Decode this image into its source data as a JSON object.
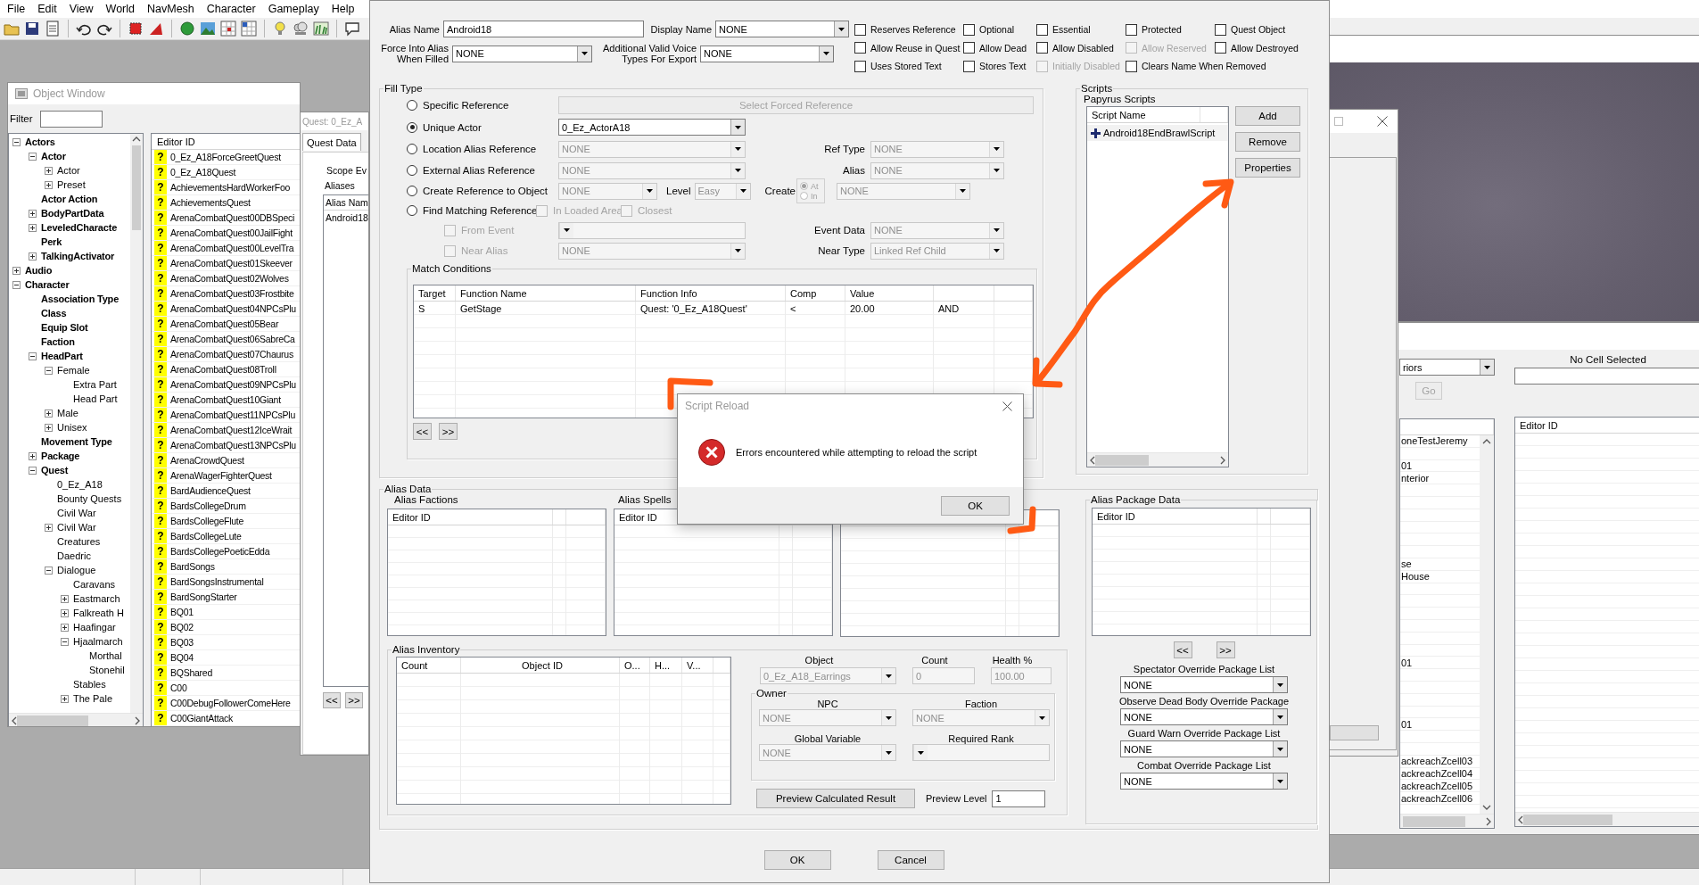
{
  "menu": [
    "File",
    "Edit",
    "View",
    "World",
    "NavMesh",
    "Character",
    "Gameplay",
    "Help"
  ],
  "object_window": {
    "title": "Object Window",
    "filter_label": "Filter",
    "list_header": "Editor ID",
    "tree": [
      {
        "label": "Actors",
        "expanded": true,
        "children": [
          {
            "label": "Actor",
            "expanded": true,
            "children": [
              {
                "label": "Actor",
                "expanded": false
              },
              {
                "label": "Preset",
                "expanded": false
              }
            ]
          },
          {
            "label": "Actor Action"
          },
          {
            "label": "BodyPartData",
            "expanded": false
          },
          {
            "label": "LeveledCharacte",
            "expanded": false
          },
          {
            "label": "Perk"
          },
          {
            "label": "TalkingActivator",
            "expanded": false
          }
        ]
      },
      {
        "label": "Audio",
        "expanded": false
      },
      {
        "label": "Character",
        "expanded": true,
        "children": [
          {
            "label": "Association Type"
          },
          {
            "label": "Class"
          },
          {
            "label": "Equip Slot"
          },
          {
            "label": "Faction"
          },
          {
            "label": "HeadPart",
            "expanded": true,
            "children": [
              {
                "label": "Female",
                "expanded": true,
                "children": [
                  {
                    "label": "Extra Part"
                  },
                  {
                    "label": "Head Part"
                  }
                ]
              },
              {
                "label": "Male",
                "expanded": false
              },
              {
                "label": "Unisex",
                "expanded": false
              }
            ]
          },
          {
            "label": "Movement Type"
          },
          {
            "label": "Package",
            "expanded": false
          },
          {
            "label": "Quest",
            "expanded": true,
            "children": [
              {
                "label": "0_Ez_A18"
              },
              {
                "label": "Bounty Quests"
              },
              {
                "label": "Civil War"
              },
              {
                "label": "Civil War",
                "expanded": false
              },
              {
                "label": "Creatures"
              },
              {
                "label": "Daedric"
              },
              {
                "label": "Dialogue",
                "expanded": true,
                "children": [
                  {
                    "label": "Caravans"
                  },
                  {
                    "label": "Eastmarch",
                    "expanded": false
                  },
                  {
                    "label": "Falkreath H",
                    "expanded": false
                  },
                  {
                    "label": "Haafingar",
                    "expanded": false
                  },
                  {
                    "label": "Hjaalmarch",
                    "expanded": true,
                    "children": [
                      {
                        "label": "Morthal"
                      },
                      {
                        "label": "Stonehil"
                      }
                    ]
                  },
                  {
                    "label": "Stables"
                  },
                  {
                    "label": "The Pale",
                    "expanded": false
                  }
                ]
              }
            ]
          }
        ]
      }
    ],
    "list": [
      {
        "mark": "?",
        "name": "0_Ez_A18ForceGreetQuest"
      },
      {
        "mark": "?",
        "name": "0_Ez_A18Quest"
      },
      {
        "mark": "?",
        "name": "AchievementsHardWorkerFoo"
      },
      {
        "mark": "?",
        "name": "AchievementsQuest"
      },
      {
        "mark": "?",
        "name": "ArenaCombatQuest00DBSpeci"
      },
      {
        "mark": "?",
        "name": "ArenaCombatQuest00JailFight"
      },
      {
        "mark": "?",
        "name": "ArenaCombatQuest00LevelTra"
      },
      {
        "mark": "?",
        "name": "ArenaCombatQuest01Skeever"
      },
      {
        "mark": "?",
        "name": "ArenaCombatQuest02Wolves"
      },
      {
        "mark": "?",
        "name": "ArenaCombatQuest03Frostbite"
      },
      {
        "mark": "?",
        "name": "ArenaCombatQuest04NPCsPlu"
      },
      {
        "mark": "?",
        "name": "ArenaCombatQuest05Bear"
      },
      {
        "mark": "?",
        "name": "ArenaCombatQuest06SabreCa"
      },
      {
        "mark": "?",
        "name": "ArenaCombatQuest07Chaurus"
      },
      {
        "mark": "?",
        "name": "ArenaCombatQuest08Troll"
      },
      {
        "mark": "?",
        "name": "ArenaCombatQuest09NPCsPlu"
      },
      {
        "mark": "?",
        "name": "ArenaCombatQuest10Giant"
      },
      {
        "mark": "?",
        "name": "ArenaCombatQuest11NPCsPlu"
      },
      {
        "mark": "?",
        "name": "ArenaCombatQuest12IceWrait"
      },
      {
        "mark": "?",
        "name": "ArenaCombatQuest13NPCsPlu"
      },
      {
        "mark": "?",
        "name": "ArenaCrowdQuest"
      },
      {
        "mark": "?",
        "name": "ArenaWagerFighterQuest"
      },
      {
        "mark": "?",
        "name": "BardAudienceQuest"
      },
      {
        "mark": "?",
        "name": "BardsCollegeDrum"
      },
      {
        "mark": "?",
        "name": "BardsCollegeFlute"
      },
      {
        "mark": "?",
        "name": "BardsCollegeLute"
      },
      {
        "mark": "?",
        "name": "BardsCollegePoeticEdda"
      },
      {
        "mark": "?",
        "name": "BardSongs"
      },
      {
        "mark": "?",
        "name": "BardSongsInstrumental"
      },
      {
        "mark": "?",
        "name": "BardSongStarter"
      },
      {
        "mark": "?",
        "name": "BQ01"
      },
      {
        "mark": "?",
        "name": "BQ02"
      },
      {
        "mark": "?",
        "name": "BQ03"
      },
      {
        "mark": "?",
        "name": "BQ04"
      },
      {
        "mark": "?",
        "name": "BQShared"
      },
      {
        "mark": "?",
        "name": "C00"
      },
      {
        "mark": "?",
        "name": "C00DebugFollowerComeHere"
      },
      {
        "mark": "?",
        "name": "C00GiantAttack"
      }
    ]
  },
  "quest_window": {
    "title": "Quest: 0_Ez_A",
    "tabs": [
      {
        "label": "Quest Data",
        "selected": true
      }
    ],
    "scope_label": "Scope Ev",
    "aliases_label": "Aliases",
    "alias_column": "Alias Nam",
    "aliases": [
      "Android18"
    ],
    "nav_buttons": [
      "<<",
      ">>"
    ]
  },
  "reference_alias": {
    "alias_name": {
      "label": "Alias Name",
      "value": "Android18"
    },
    "display_name": {
      "label": "Display Name",
      "value": "NONE"
    },
    "force_into_alias": {
      "label": "Force Into Alias When Filled",
      "value": "NONE"
    },
    "voice_types": {
      "label": "Additional Valid Voice Types For Export",
      "value": "NONE"
    },
    "flags": [
      {
        "label": "Reserves Reference",
        "checked": false,
        "disabled": false
      },
      {
        "label": "Optional",
        "checked": false,
        "disabled": false
      },
      {
        "label": "Essential",
        "checked": false,
        "disabled": false
      },
      {
        "label": "Protected",
        "checked": false,
        "disabled": false
      },
      {
        "label": "Quest Object",
        "checked": false,
        "disabled": false
      },
      {
        "label": "Allow Reuse in Quest",
        "checked": false,
        "disabled": false
      },
      {
        "label": "Allow Dead",
        "checked": false,
        "disabled": false
      },
      {
        "label": "Allow Disabled",
        "checked": false,
        "disabled": false
      },
      {
        "label": "Allow Reserved",
        "checked": false,
        "disabled": true
      },
      {
        "label": "Allow Destroyed",
        "checked": false,
        "disabled": false
      },
      {
        "label": "Uses Stored Text",
        "checked": false,
        "disabled": false
      },
      {
        "label": "Stores Text",
        "checked": false,
        "disabled": false
      },
      {
        "label": "Initially Disabled",
        "checked": false,
        "disabled": true
      },
      {
        "label": "Clears Name When Removed",
        "checked": false,
        "disabled": false
      }
    ],
    "fill_type": {
      "title": "Fill Type",
      "specific": {
        "label": "Specific Reference",
        "selected": false,
        "disabled": true,
        "button": "Select Forced Reference"
      },
      "unique": {
        "label": "Unique Actor",
        "selected": true,
        "disabled": false,
        "value": "0_Ez_ActorA18"
      },
      "location": {
        "label": "Location Alias Reference",
        "selected": false,
        "disabled": true,
        "value": "NONE",
        "ref_type_label": "Ref Type",
        "ref_type": "NONE"
      },
      "external": {
        "label": "External Alias Reference",
        "selected": false,
        "disabled": true,
        "value": "NONE",
        "alias_label": "Alias",
        "alias": "NONE"
      },
      "create": {
        "label": "Create Reference to Object",
        "selected": false,
        "disabled": true,
        "value": "NONE",
        "level_label": "Level",
        "level": "Easy",
        "create_label": "Create",
        "at": {
          "label": "At",
          "selected": true
        },
        "in": {
          "label": "In",
          "selected": false
        },
        "target": "NONE"
      },
      "find": {
        "label": "Find Matching Reference",
        "selected": false,
        "disabled": true,
        "in_loaded_area": {
          "label": "In Loaded Area",
          "checked": false
        },
        "closest": {
          "label": "Closest",
          "checked": false
        }
      },
      "from_event": {
        "label": "From Event",
        "checked": false,
        "disabled": true,
        "event_data_label": "Event Data",
        "event_data": "NONE"
      },
      "near_alias": {
        "label": "Near Alias",
        "checked": false,
        "disabled": true,
        "value": "NONE",
        "near_type_label": "Near Type",
        "near_type": "Linked Ref Child"
      },
      "match_conditions": {
        "title": "Match Conditions",
        "columns": [
          "Target",
          "Function Name",
          "Function Info",
          "Comp",
          "Value"
        ],
        "rows": [
          [
            "S",
            "GetStage",
            "Quest: '0_Ez_A18Quest'",
            "<",
            "20.00",
            "AND"
          ]
        ],
        "nav_buttons": [
          "<<",
          ">>"
        ]
      }
    },
    "scripts": {
      "title": "Scripts",
      "subtitle": "Papyrus Scripts",
      "column": "Script Name",
      "items": [
        "Android18EndBrawlScript"
      ],
      "buttons": [
        "Add",
        "Remove",
        "Properties"
      ]
    },
    "alias_data": {
      "title": "Alias Data",
      "factions": {
        "title": "Alias Factions",
        "column": "Editor ID"
      },
      "spells": {
        "title": "Alias Spells",
        "column": "Editor ID"
      },
      "inventory": {
        "title": "Alias Inventory",
        "columns": [
          "Count",
          "Object ID",
          "O...",
          "H...",
          "V..."
        ],
        "object_label": "Object",
        "object": "0_Ez_A18_Earrings",
        "count_label": "Count",
        "count": "0",
        "health_label": "Health %",
        "health": "100.00",
        "owner": {
          "title": "Owner",
          "npc_label": "NPC",
          "npc": "NONE",
          "faction_label": "Faction",
          "faction": "NONE",
          "global_label": "Global Variable",
          "global": "NONE",
          "rank_label": "Required Rank"
        },
        "preview_button": "Preview Calculated Result",
        "preview_level_label": "Preview Level",
        "preview_level": "1"
      },
      "package": {
        "title": "Alias Package Data",
        "column": "Editor ID",
        "nav_buttons": [
          "<<",
          ">>"
        ],
        "overrides": [
          {
            "label": "Spectator Override Package List",
            "value": "NONE"
          },
          {
            "label": "Observe Dead Body Override Package",
            "value": "NONE"
          },
          {
            "label": "Guard Warn Override Package List",
            "value": "NONE"
          },
          {
            "label": "Combat Override Package List",
            "value": "NONE"
          }
        ]
      }
    },
    "buttons": [
      "OK",
      "Cancel"
    ]
  },
  "script_reload": {
    "title": "Script Reload",
    "message": "Errors encountered while attempting to reload the script",
    "button": "OK"
  },
  "cell_view": {
    "world": "riors",
    "go_button": "Go",
    "status": "No Cell Selected",
    "list_header": "Editor ID",
    "cells": [
      {
        "text": "oneTestJeremy"
      },
      {},
      {
        "text": "01"
      },
      {
        "text": "nterior"
      },
      {},
      {},
      {},
      {},
      {},
      {},
      {
        "text": "se"
      },
      {
        "text": "House"
      },
      {},
      {},
      {},
      {},
      {},
      {},
      {
        "text": "01"
      },
      {},
      {},
      {},
      {},
      {
        "text": "01"
      },
      {},
      {},
      {
        "text": "ackreachZcell03"
      },
      {
        "text": "ackreachZcell04"
      },
      {
        "text": "ackreachZcell05"
      },
      {
        "text": "ackreachZcell06"
      }
    ]
  }
}
